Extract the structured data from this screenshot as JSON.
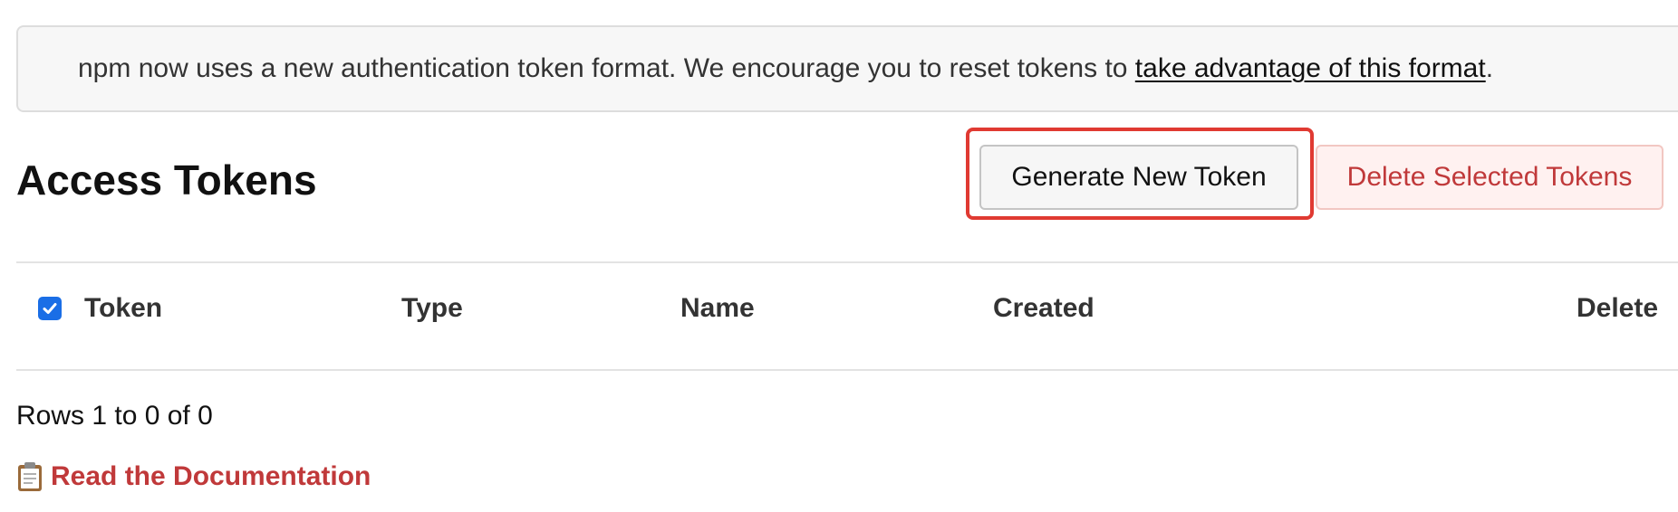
{
  "notice": {
    "text": "npm now uses a new authentication token format. We encourage you to reset tokens to ",
    "link_text": "take advantage of this format",
    "suffix": "."
  },
  "header": {
    "title": "Access Tokens",
    "generate_label": "Generate New Token",
    "delete_selected_label": "Delete Selected Tokens"
  },
  "table": {
    "select_all_checked": true,
    "columns": [
      "Token",
      "Type",
      "Name",
      "Created",
      "Delete"
    ],
    "rows": []
  },
  "footer": {
    "rows_count": "Rows 1 to 0 of 0",
    "doc_link": "Read the Documentation",
    "doc_icon": "clipboard-icon"
  },
  "colors": {
    "accent_red": "#c0393a",
    "highlight": "#e03a32",
    "checkbox_blue": "#1a6ee6"
  }
}
